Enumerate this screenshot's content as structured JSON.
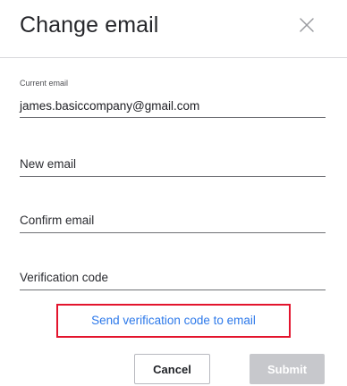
{
  "dialog": {
    "title": "Change email"
  },
  "fields": {
    "current": {
      "label": "Current email",
      "value": "james.basiccompany@gmail.com"
    },
    "new_email": {
      "placeholder": "New email"
    },
    "confirm_email": {
      "placeholder": "Confirm email"
    },
    "verification_code": {
      "placeholder": "Verification code"
    }
  },
  "actions": {
    "send_code": "Send verification code to email",
    "cancel": "Cancel",
    "submit": "Submit"
  },
  "colors": {
    "link": "#2d79ea",
    "highlight_border": "#e3142d",
    "disabled_button": "#c7c8cc"
  },
  "icons": {
    "close": "close-icon"
  }
}
